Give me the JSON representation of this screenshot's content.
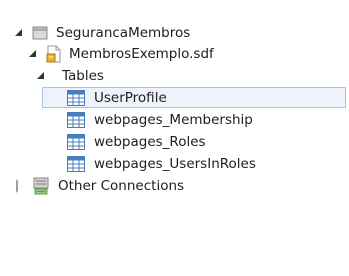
{
  "tree": {
    "root": {
      "label": "SegurancaMembros",
      "icon": "folder-icon",
      "expanded": true
    },
    "database": {
      "label": "MembrosExemplo.sdf",
      "icon": "database-file-icon",
      "expanded": true
    },
    "tables_folder": {
      "label": "Tables",
      "expanded": true
    },
    "tables": [
      {
        "label": "UserProfile",
        "icon": "table-icon",
        "selected": true
      },
      {
        "label": "webpages_Membership",
        "icon": "table-icon",
        "selected": false
      },
      {
        "label": "webpages_Roles",
        "icon": "table-icon",
        "selected": false
      },
      {
        "label": "webpages_UsersInRoles",
        "icon": "table-icon",
        "selected": false
      }
    ],
    "other_connections": {
      "label": "Other Connections",
      "icon": "server-icon",
      "expanded": false
    }
  },
  "colors": {
    "selection_bg": "#eef3fb",
    "selection_border": "#a9c4ea",
    "table_icon_blue": "#4a7cc0"
  }
}
